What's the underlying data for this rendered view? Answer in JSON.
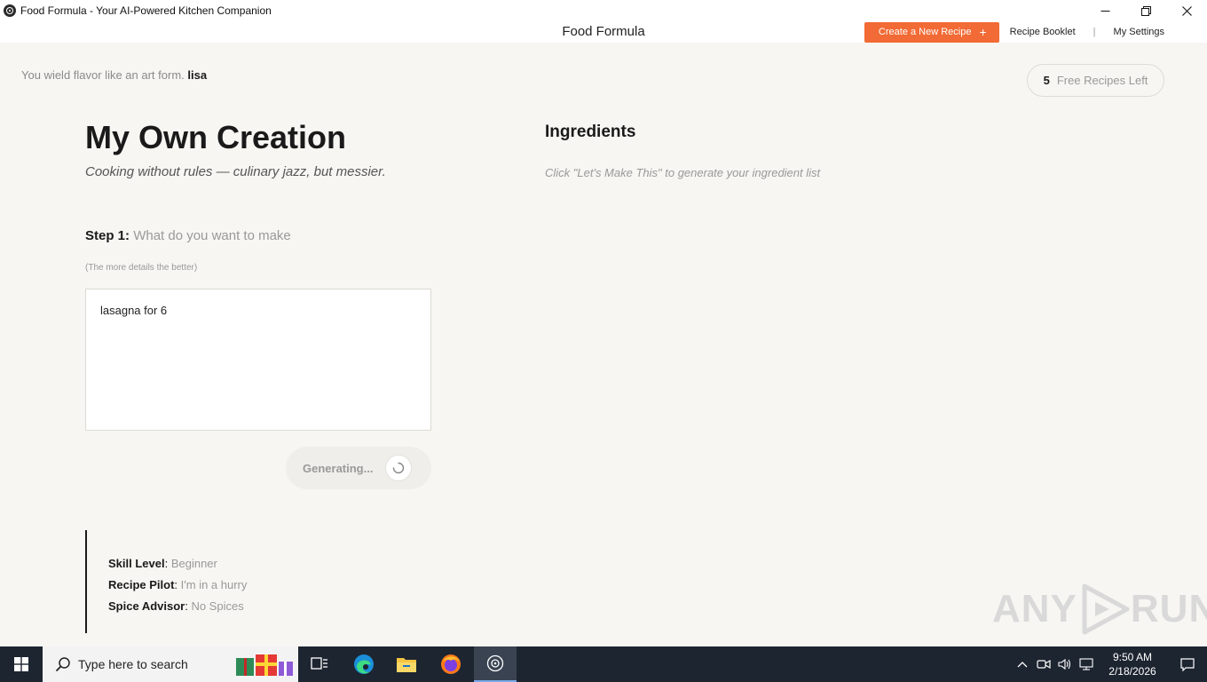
{
  "window": {
    "title": "Food Formula - Your AI-Powered Kitchen Companion"
  },
  "header": {
    "brand": "Food Formula",
    "create_label": "Create a New Recipe",
    "create_plus": "+",
    "booklet_label": "Recipe Booklet",
    "separator": "|",
    "settings_label": "My Settings"
  },
  "greeting": {
    "text": "You wield flavor like an art form.",
    "user": "lisa"
  },
  "credits": {
    "count": "5",
    "label": "Free Recipes Left"
  },
  "main": {
    "title": "My Own Creation",
    "subtitle": "Cooking without rules — culinary jazz, but messier.",
    "step_label": "Step 1:",
    "step_prompt": "What do you want to make",
    "hint": "(The more details the better)",
    "input_value": "lasagna for 6",
    "generate_label": "Generating..."
  },
  "preferences": {
    "skill_key": "Skill Level",
    "skill_value": "Beginner",
    "pilot_key": "Recipe Pilot",
    "pilot_value": "I'm in a hurry",
    "spice_key": "Spice Advisor",
    "spice_value": "No Spices"
  },
  "ingredients": {
    "title": "Ingredients",
    "hint": "Click \"Let's Make This\" to generate your ingredient list"
  },
  "watermark": {
    "left": "ANY",
    "right": "RUN"
  },
  "taskbar": {
    "search_placeholder": "Type here to search",
    "time": "9:50 AM",
    "date": "2/18/2026"
  },
  "colors": {
    "accent": "#f26a35",
    "background": "#f7f6f2",
    "taskbar": "#1d2531"
  }
}
